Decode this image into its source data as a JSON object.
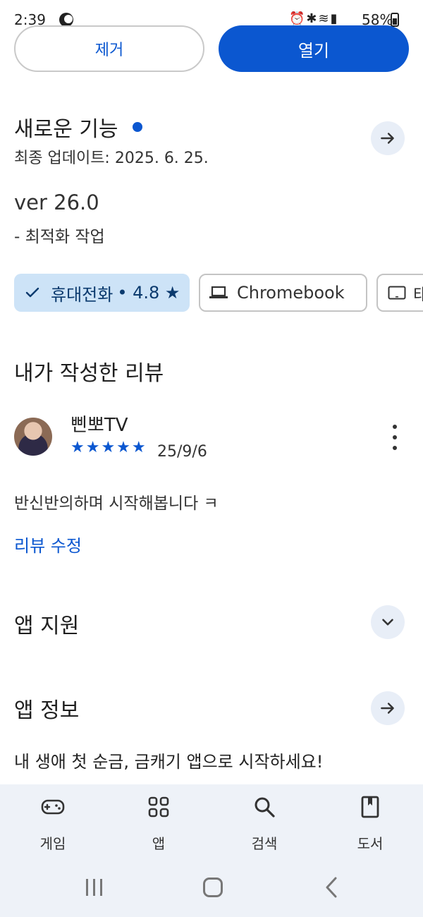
{
  "status_bar": {
    "time": "2:39",
    "icons": [
      "moon-icon",
      "alarm-icon",
      "bluetooth-icon",
      "wifi-icon",
      "signal-icon"
    ],
    "battery": "58%"
  },
  "actions": {
    "remove_label": "제거",
    "open_label": "열기"
  },
  "whats_new": {
    "title": "새로운 기능",
    "updated": "최종 업데이트: 2025. 6. 25.",
    "version": "ver 26.0",
    "change": "- 최적화 작업"
  },
  "devices": {
    "phone_label": "휴대전화",
    "phone_rating": "• 4.8 ★",
    "chromebook_label": "Chromebook",
    "tablet_label": "태"
  },
  "my_review": {
    "title": "내가 작성한 리뷰",
    "reviewer": "삔뽀TV",
    "stars": "★★★★★",
    "rating": 5,
    "date": "25/9/6",
    "body": "반신반의하며 시작해봅니다 ㅋ",
    "edit_label": "리뷰 수정"
  },
  "app_support": {
    "title": "앱 지원"
  },
  "app_info": {
    "title": "앱 정보",
    "description": "내 생애 첫 순금, 금캐기 앱으로 시작하세요!"
  },
  "bottom_nav": {
    "items": [
      {
        "label": "게임",
        "icon": "gamepad-icon"
      },
      {
        "label": "앱",
        "icon": "apps-grid-icon"
      },
      {
        "label": "검색",
        "icon": "search-icon"
      },
      {
        "label": "도서",
        "icon": "book-icon"
      }
    ]
  },
  "colors": {
    "accent": "#0b57d0",
    "chip_selected": "#cde3f7",
    "nav_bg": "#eef2f8"
  }
}
